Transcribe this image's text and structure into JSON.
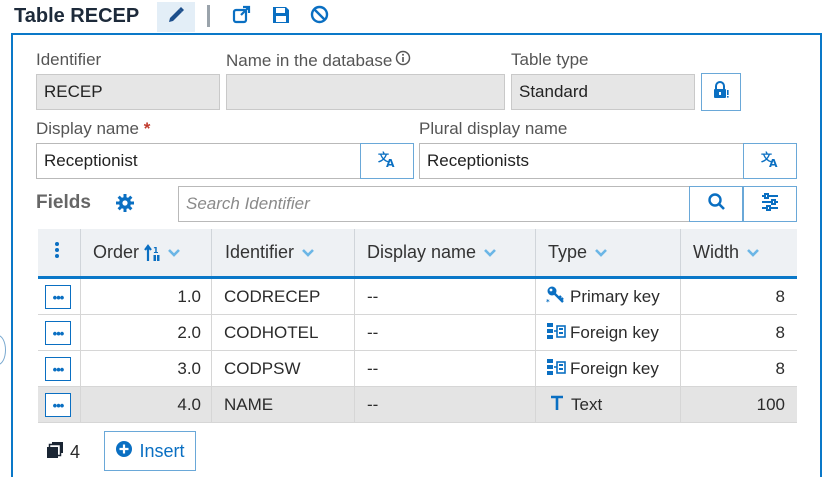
{
  "header": {
    "title": "Table RECEP",
    "icons": [
      "pencil-icon",
      "external-link-icon",
      "save-icon",
      "cancel-icon"
    ]
  },
  "form": {
    "identifier_label": "Identifier",
    "identifier_value": "RECEP",
    "dbname_label": "Name in the database",
    "dbname_value": "",
    "tabletype_label": "Table type",
    "tabletype_value": "Standard",
    "display_label": "Display name",
    "display_required": "*",
    "display_value": "Receptionist",
    "plural_label": "Plural display name",
    "plural_value": "Receptionists"
  },
  "fields": {
    "label": "Fields",
    "search_placeholder": "Search Identifier",
    "columns": {
      "order": "Order",
      "identifier": "Identifier",
      "display_name": "Display name",
      "type": "Type",
      "width": "Width"
    },
    "rows": [
      {
        "order": "1.0",
        "identifier": "CODRECEP",
        "display_name": "--",
        "type": "Primary key",
        "type_icon": "key-icon",
        "width": "8",
        "selected": false
      },
      {
        "order": "2.0",
        "identifier": "CODHOTEL",
        "display_name": "--",
        "type": "Foreign key",
        "type_icon": "foreign-key-icon",
        "width": "8",
        "selected": false
      },
      {
        "order": "3.0",
        "identifier": "CODPSW",
        "display_name": "--",
        "type": "Foreign key",
        "type_icon": "foreign-key-icon",
        "width": "8",
        "selected": false
      },
      {
        "order": "4.0",
        "identifier": "NAME",
        "display_name": "--",
        "type": "Text",
        "type_icon": "text-type-icon",
        "width": "100",
        "selected": true
      }
    ]
  },
  "footer": {
    "count": "4",
    "insert_label": "Insert"
  },
  "colors": {
    "accent": "#0a78c8",
    "required": "#c0392b",
    "readonly_bg": "#e6e6e6",
    "selected_row": "#e4e4e4"
  }
}
